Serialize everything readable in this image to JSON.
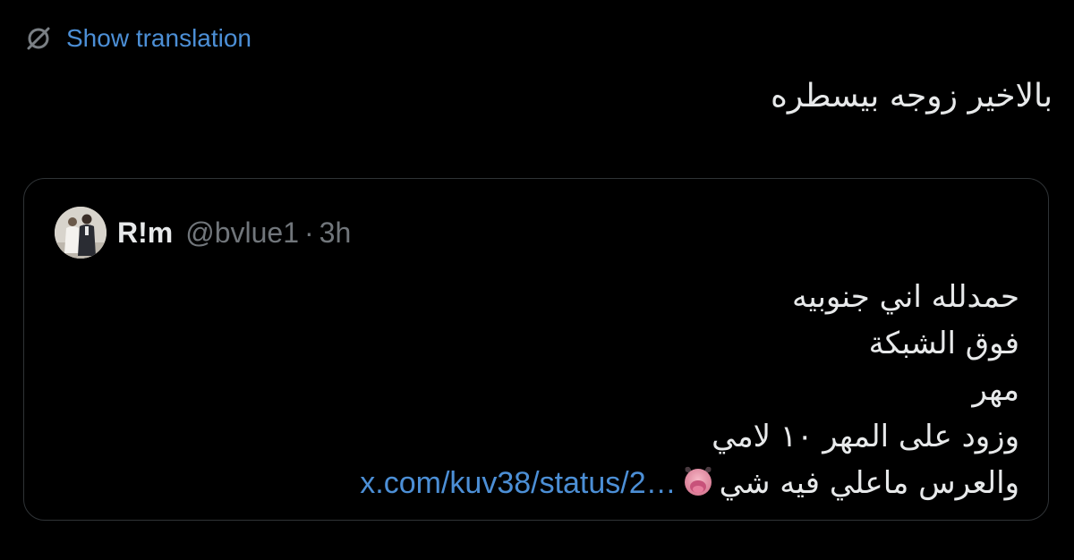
{
  "translation": {
    "label": "Show translation",
    "icon": "translate-globe-slash-icon",
    "color": "#4c8fd6"
  },
  "tweet": {
    "text": "بالاخير زوجه بيسطره"
  },
  "quote": {
    "avatar_icon": "profile-photo",
    "author_name": "R!m",
    "author_handle": "@bvlue1",
    "separator": "·",
    "time": "3h",
    "lines": [
      "حمدلله اني جنوبيه",
      "فوق الشبكة",
      "مهر",
      "وزود على المهر ١٠ لامي",
      "والعرس ماعلي فيه شي"
    ],
    "emoji": "tongue-face-emoji",
    "link_text": "x.com/kuv38/status/2…",
    "link_color": "#4c8fd6"
  },
  "colors": {
    "background": "#000000",
    "text": "#e7e9ea",
    "secondary": "#71767b",
    "border": "#2f3336"
  }
}
